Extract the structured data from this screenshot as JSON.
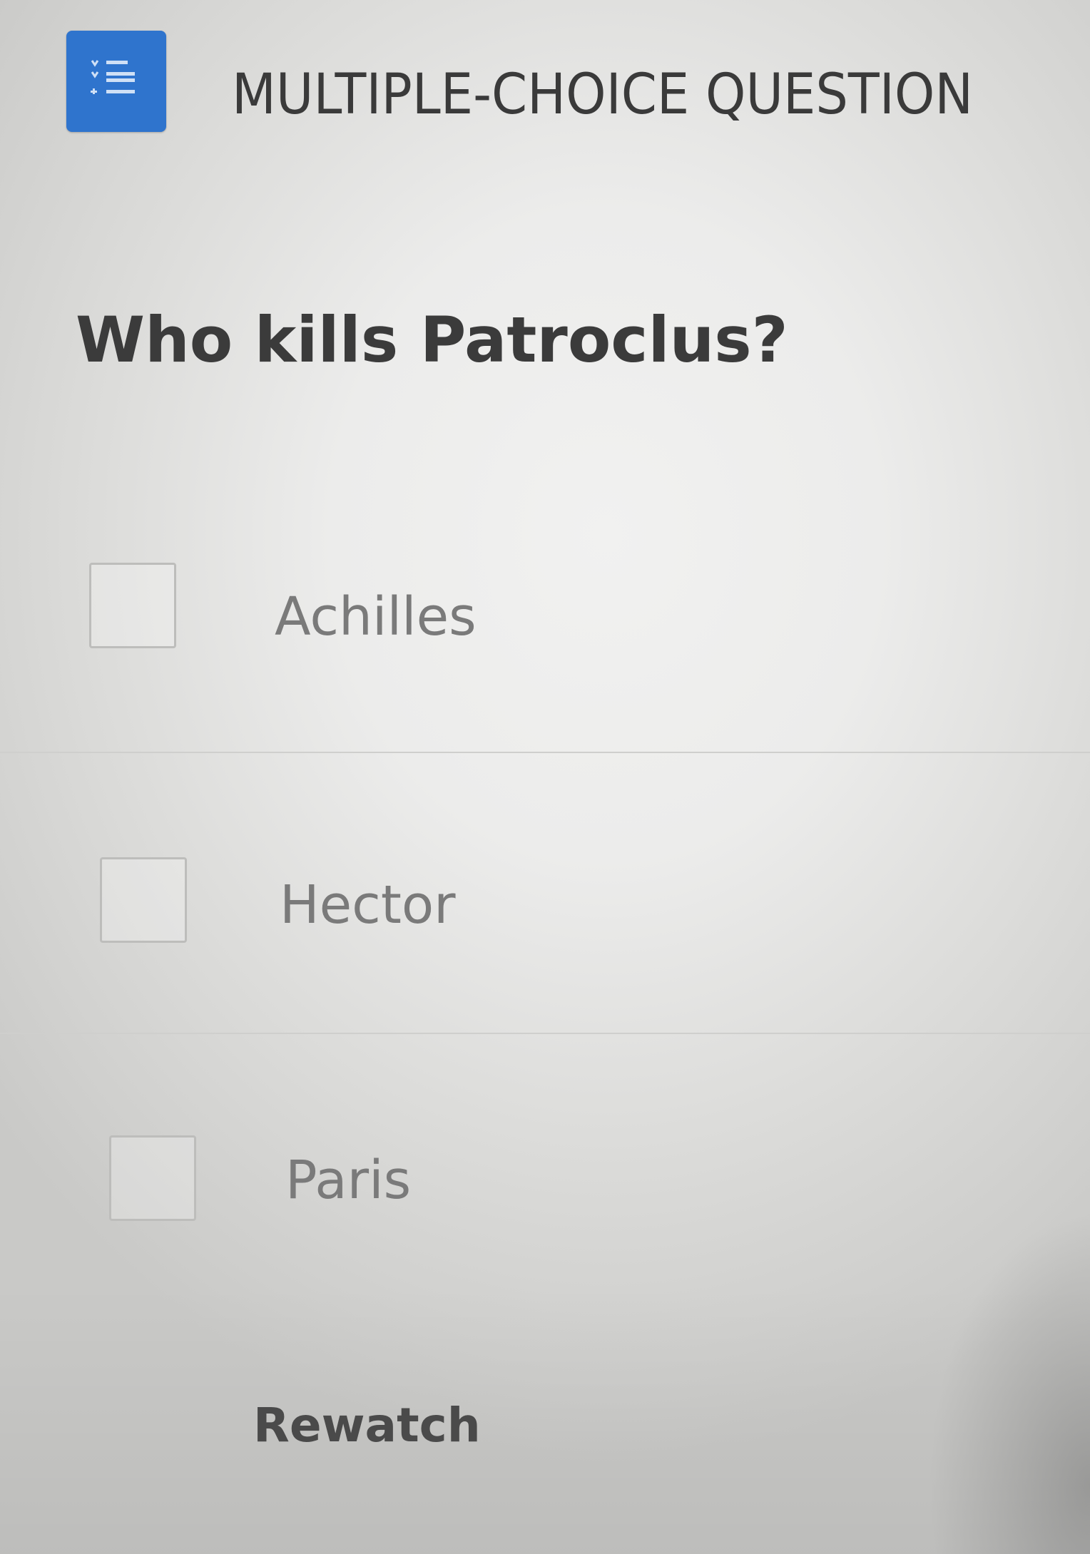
{
  "header": {
    "icon": "numbered-list-icon",
    "title": "MULTIPLE-CHOICE QUESTION",
    "accent_color": "#2f74cd"
  },
  "question": {
    "text": "Who kills Patroclus?"
  },
  "options": [
    {
      "label": "Achilles",
      "checked": false
    },
    {
      "label": "Hector",
      "checked": false
    },
    {
      "label": "Paris",
      "checked": false
    }
  ],
  "actions": {
    "rewatch_label": "Rewatch"
  }
}
